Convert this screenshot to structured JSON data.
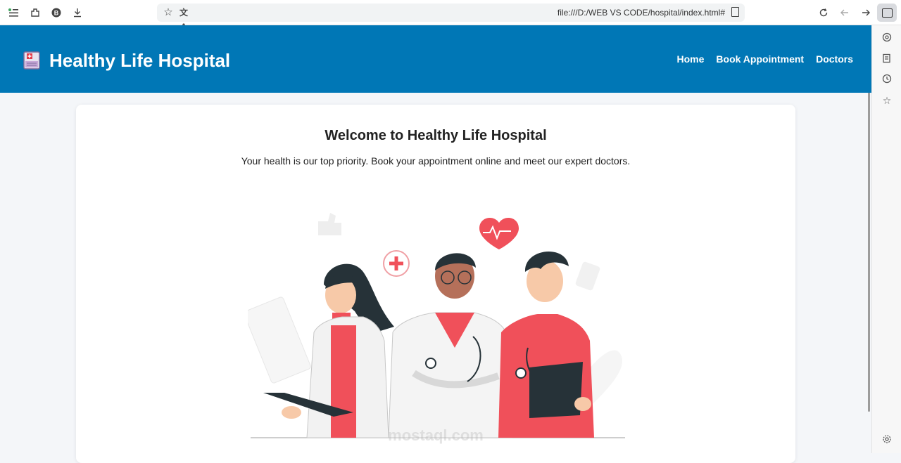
{
  "browser": {
    "url": "file:///D:/WEB VS CODE/hospital/index.html#"
  },
  "header": {
    "title": "Healthy Life Hospital",
    "nav": [
      "Home",
      "Book Appointment",
      "Doctors"
    ]
  },
  "main": {
    "heading": "Welcome to Healthy Life Hospital",
    "intro": "Your health is our top priority. Book your appointment online and meet our expert doctors.",
    "watermark": "mostaql.com"
  },
  "colors": {
    "header_bg": "#0077b6",
    "accent_red": "#f0505a"
  }
}
